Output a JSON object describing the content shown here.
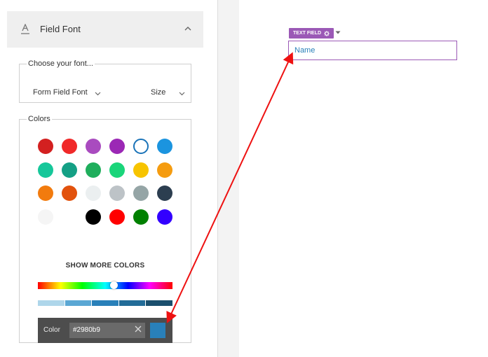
{
  "panel": {
    "section_title": "Field Font",
    "font_group": {
      "legend": "Choose your font...",
      "font_select": "Form Field Font",
      "size_select": "Size"
    },
    "colors_group": {
      "legend": "Colors",
      "swatches": [
        [
          "#d32020",
          "#f02929",
          "#a94bbf",
          "#9b28b5",
          "#ffffff",
          "#1b94df"
        ],
        [
          "#16c79a",
          "#14a085",
          "#1fae5c",
          "#1ad57a",
          "#f7c400",
          "#f59c10"
        ],
        [
          "#f27b0e",
          "#e2520d",
          "#ebeff0",
          "#bdc3c7",
          "#95a5a6",
          "#2c3e50"
        ],
        [
          "#f5f5f5",
          null,
          "#000000",
          "#ff0000",
          "#008000",
          "#3300ff"
        ]
      ],
      "selected_swatch": "#ffffff",
      "show_more_label": "SHOW MORE COLORS",
      "shades": [
        "#aed6ea",
        "#5aa7d4",
        "#2980b9",
        "#226c98",
        "#1a4f6d"
      ],
      "color_label": "Color",
      "color_value": "#2980b9",
      "accent_color": "#2980b9"
    }
  },
  "canvas": {
    "tag_label": "TEXT FIELD",
    "field_placeholder": "Name",
    "tag_color": "#9b59b6"
  },
  "annotation": {
    "arrow_color": "#ee1111"
  }
}
